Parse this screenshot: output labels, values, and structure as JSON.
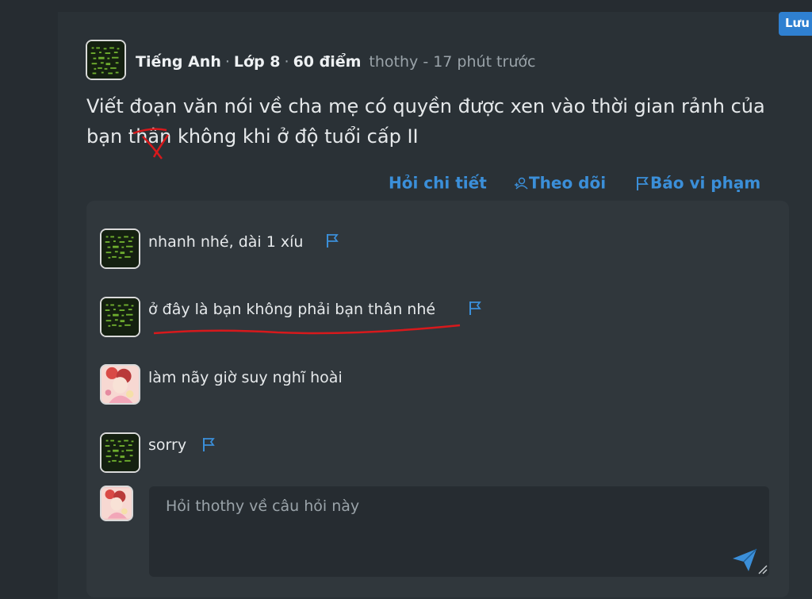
{
  "save_badge": "Lưu",
  "question": {
    "subject": "Tiếng Anh",
    "grade": "Lớp 8",
    "points": "60 điểm",
    "author_time": "thothy - 17 phút trước",
    "text": "Viết đoạn văn nói về cha mẹ có quyền được xen vào thời gian rảnh của bạn thân không khi ở độ tuổi cấp II"
  },
  "actions": {
    "ask_detail": "Hỏi chi tiết",
    "follow": "Theo dõi",
    "report": "Báo vi phạm"
  },
  "comments": [
    {
      "text": "nhanh nhé, dài 1 xíu",
      "avatar": "green-matrix",
      "flag": true
    },
    {
      "text": "ở đây là bạn không phải bạn thân nhé",
      "avatar": "green-matrix",
      "flag": true
    },
    {
      "text": "làm nãy giờ suy nghĩ hoài",
      "avatar": "pink-anime",
      "flag": false
    },
    {
      "text": "sorry",
      "avatar": "green-matrix",
      "flag": true
    }
  ],
  "reply": {
    "placeholder": "Hỏi thothy về câu hỏi này"
  },
  "colors": {
    "accent": "#3b8fd9",
    "annotation_red": "#d7191c"
  }
}
